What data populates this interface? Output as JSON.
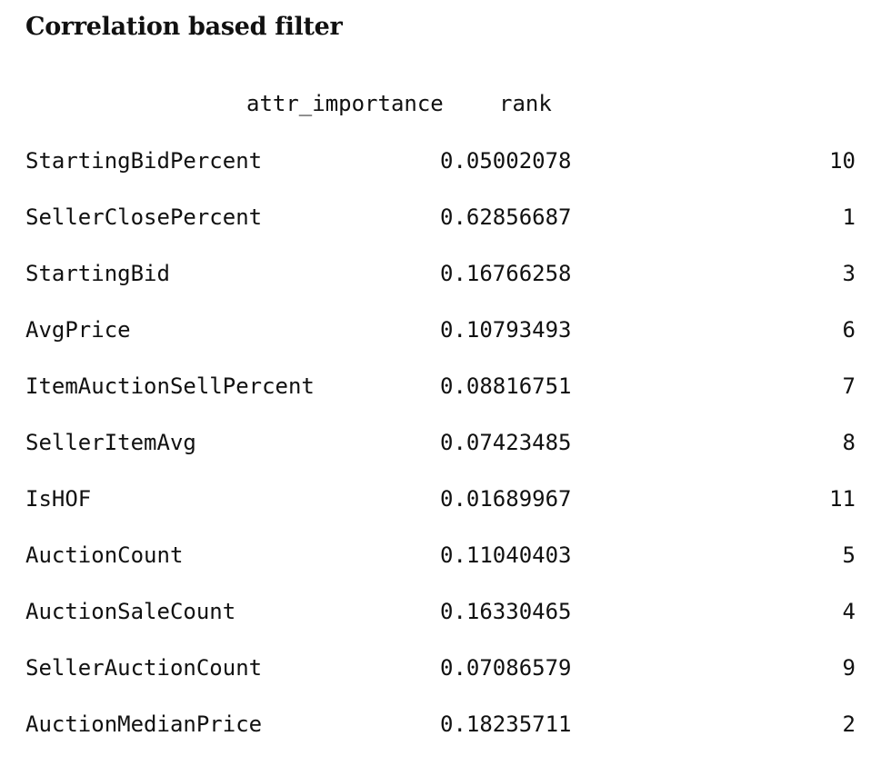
{
  "title": "Correlation based filter",
  "table": {
    "columns": [
      "attr_importance",
      "rank"
    ],
    "rows": [
      {
        "name": "StartingBidPercent",
        "attr_importance": "0.05002078",
        "rank": "10"
      },
      {
        "name": "SellerClosePercent",
        "attr_importance": "0.62856687",
        "rank": "1"
      },
      {
        "name": "StartingBid",
        "attr_importance": "0.16766258",
        "rank": "3"
      },
      {
        "name": "AvgPrice",
        "attr_importance": "0.10793493",
        "rank": "6"
      },
      {
        "name": "ItemAuctionSellPercent",
        "attr_importance": "0.08816751",
        "rank": "7"
      },
      {
        "name": "SellerItemAvg",
        "attr_importance": "0.07423485",
        "rank": "8"
      },
      {
        "name": "IsHOF",
        "attr_importance": "0.01689967",
        "rank": "11"
      },
      {
        "name": "AuctionCount",
        "attr_importance": "0.11040403",
        "rank": "5"
      },
      {
        "name": "AuctionSaleCount",
        "attr_importance": "0.16330465",
        "rank": "4"
      },
      {
        "name": "SellerAuctionCount",
        "attr_importance": "0.07086579",
        "rank": "9"
      },
      {
        "name": "AuctionMedianPrice",
        "attr_importance": "0.18235711",
        "rank": "2"
      }
    ]
  }
}
